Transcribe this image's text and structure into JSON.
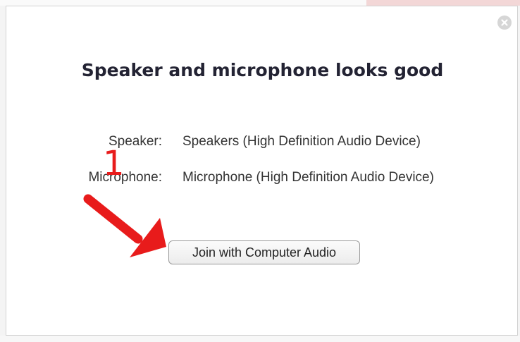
{
  "dialog": {
    "title": "Speaker and microphone looks good",
    "speaker": {
      "label": "Speaker:",
      "value": "Speakers (High Definition Audio Device)"
    },
    "microphone": {
      "label": "Microphone:",
      "value": "Microphone (High Definition Audio Device)"
    },
    "join_button_label": "Join with Computer Audio",
    "close_icon": "close-icon"
  },
  "annotation": {
    "step_number": "1",
    "arrow_icon": "arrow-icon",
    "color": "#e81b1b"
  }
}
